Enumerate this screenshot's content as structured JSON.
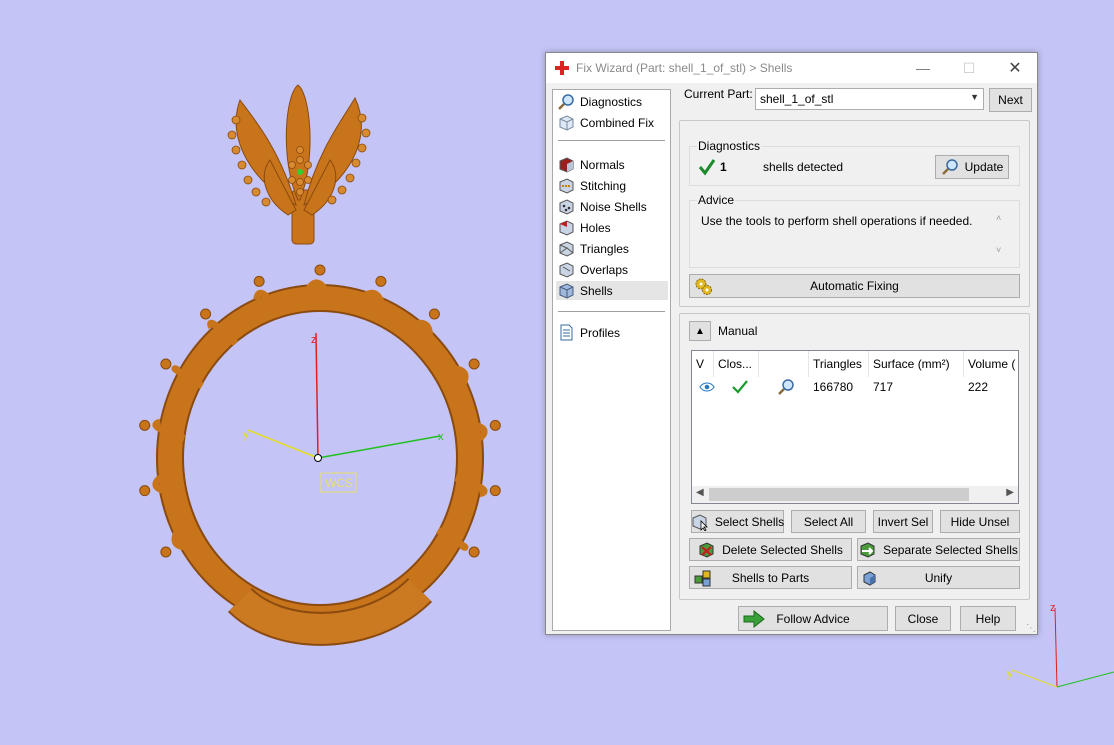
{
  "viewport": {
    "wcs_label": "WCS",
    "axis_labels": {
      "z": "z",
      "x": "x",
      "y": "y"
    },
    "corner_axis_labels": {
      "z": "z",
      "x": "x",
      "y": "y"
    },
    "colors": {
      "background": "#c4c4f6",
      "model": "#c8741a",
      "z_axis": "#e02020",
      "x_axis": "#20c020",
      "y_axis": "#e6e020"
    }
  },
  "dialog": {
    "title": "Fix Wizard (Part: shell_1_of_stl) > Shells",
    "title_icon": "red-cross-icon",
    "nav": {
      "group1": [
        {
          "label": "Diagnostics",
          "icon": "magnifier-icon"
        },
        {
          "label": "Combined Fix",
          "icon": "cube-outline-icon"
        }
      ],
      "group2": [
        {
          "label": "Normals",
          "icon": "normals-icon"
        },
        {
          "label": "Stitching",
          "icon": "stitching-icon"
        },
        {
          "label": "Noise Shells",
          "icon": "noise-shells-icon"
        },
        {
          "label": "Holes",
          "icon": "holes-icon"
        },
        {
          "label": "Triangles",
          "icon": "triangles-icon"
        },
        {
          "label": "Overlaps",
          "icon": "overlaps-icon"
        },
        {
          "label": "Shells",
          "icon": "shells-icon",
          "selected": true
        }
      ],
      "group3": [
        {
          "label": "Profiles",
          "icon": "document-icon"
        }
      ]
    },
    "current_part": {
      "label": "Current Part:",
      "value": "shell_1_of_stl",
      "next_label": "Next"
    },
    "diagnostics": {
      "title": "Diagnostics",
      "count": "1",
      "text": "shells detected",
      "update_label": "Update"
    },
    "advice": {
      "title": "Advice",
      "text": "Use the tools to perform shell operations if needed."
    },
    "automatic_fixing_label": "Automatic Fixing",
    "manual": {
      "title": "Manual",
      "table": {
        "headers": [
          "V",
          "Clos...",
          "",
          "Triangles",
          "Surface (mm²)",
          "Volume ("
        ],
        "rows": [
          {
            "visible_icon": "eye-icon",
            "closed_icon": "checkmark-icon",
            "inspect_icon": "magnifier-icon",
            "triangles": "166780",
            "surface": "717",
            "volume": "222"
          }
        ]
      },
      "buttons": {
        "select_shells": "Select Shells",
        "select_all": "Select All",
        "invert_sel": "Invert Sel",
        "hide_unsel": "Hide Unsel",
        "delete_selected": "Delete Selected Shells",
        "separate_selected": "Separate Selected Shells",
        "shells_to_parts": "Shells to Parts",
        "unify": "Unify"
      }
    },
    "footer": {
      "follow_advice": "Follow Advice",
      "close": "Close",
      "help": "Help"
    }
  }
}
